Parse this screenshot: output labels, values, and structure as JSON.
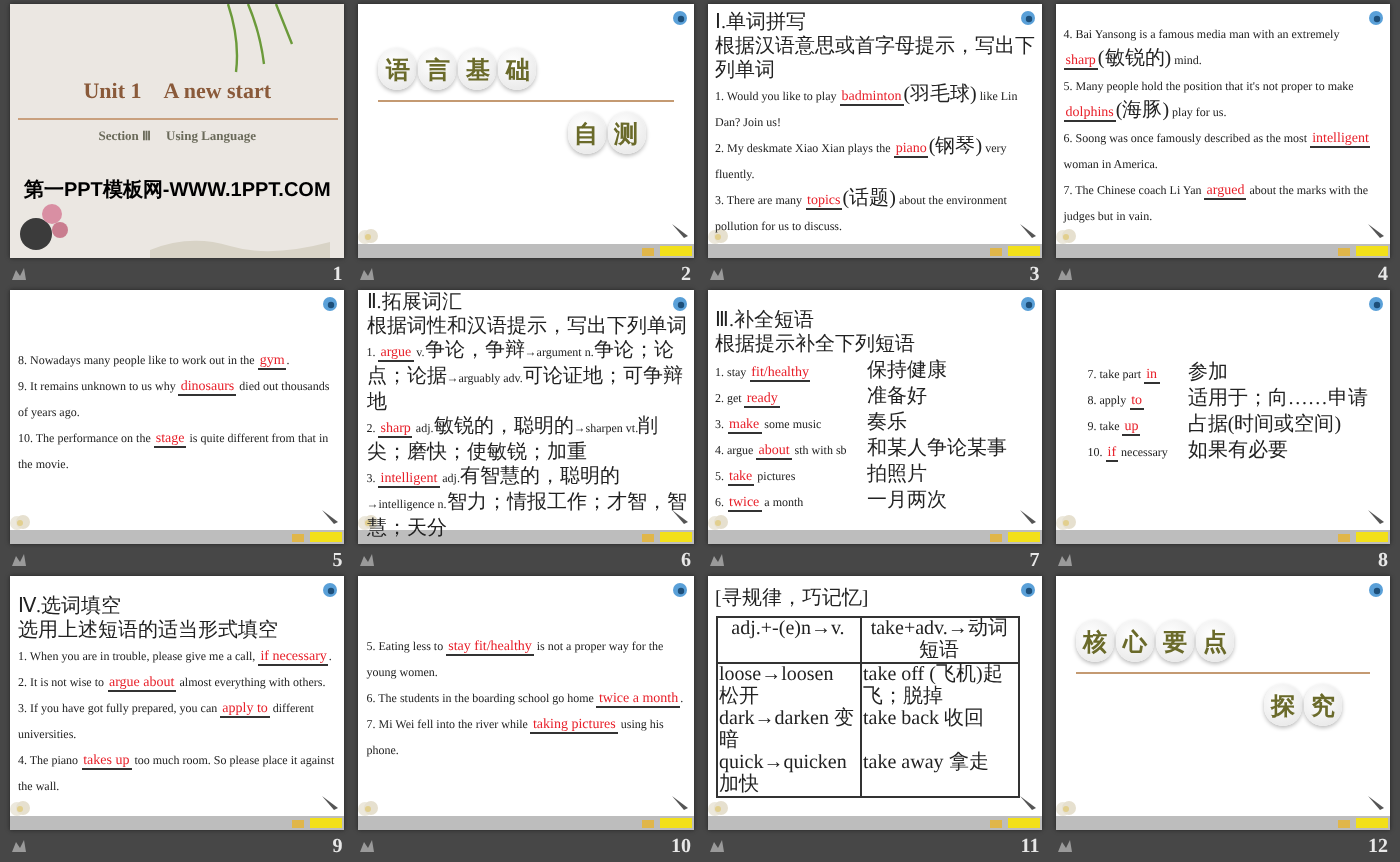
{
  "slides": [
    {
      "number": "1",
      "kind": "title",
      "title": "Unit 1　A new start",
      "subtitle": "Section Ⅲ　Using Language",
      "footer": "第一PPT模板网-WWW.1PPT.COM"
    },
    {
      "number": "2",
      "kind": "section",
      "heading_chars": [
        "语",
        "言",
        "基",
        "础"
      ],
      "sub_chars": [
        "自",
        "测"
      ]
    },
    {
      "number": "3",
      "kind": "exercise",
      "lines": [
        [
          {
            "kind": "cn",
            "text": "Ⅰ.单词拼写"
          }
        ],
        [
          {
            "kind": "cn",
            "text": "根据汉语意思或首字母提示，写出下列单词"
          }
        ],
        [
          {
            "kind": "text",
            "text": "1. Would you like to play "
          },
          {
            "kind": "answer",
            "text": "badminton"
          },
          {
            "kind": "cn",
            "text": "(羽毛球)"
          },
          {
            "kind": "text",
            "text": " like Lin Dan? Join us!"
          }
        ],
        [
          {
            "kind": "text",
            "text": "2. My deskmate Xiao Xian plays the "
          },
          {
            "kind": "answer",
            "text": "piano"
          },
          {
            "kind": "cn",
            "text": "(钢琴)"
          },
          {
            "kind": "text",
            "text": " very fluently."
          }
        ],
        [
          {
            "kind": "text",
            "text": "3. There are many "
          },
          {
            "kind": "answer",
            "text": "topics"
          },
          {
            "kind": "cn",
            "text": "(话题)"
          },
          {
            "kind": "text",
            "text": " about the environment pollution for us to discuss."
          }
        ]
      ]
    },
    {
      "number": "4",
      "kind": "exercise",
      "lines": [
        [
          {
            "kind": "text",
            "text": "4. Bai Yansong is a famous media man with an extremely "
          },
          {
            "kind": "answer",
            "text": "sharp"
          },
          {
            "kind": "cn",
            "text": "(敏锐的)"
          },
          {
            "kind": "text",
            "text": " mind."
          }
        ],
        [
          {
            "kind": "text",
            "text": "5. Many people hold the position that it's not proper to make "
          },
          {
            "kind": "answer",
            "text": "dolphins"
          },
          {
            "kind": "cn",
            "text": "(海豚)"
          },
          {
            "kind": "text",
            "text": " play for us."
          }
        ],
        [
          {
            "kind": "text",
            "text": "6. Soong was once famously described as the most "
          },
          {
            "kind": "answer",
            "text": "intelligent"
          },
          {
            "kind": "text",
            "text": " woman in America."
          }
        ],
        [
          {
            "kind": "text",
            "text": "7. The Chinese coach Li Yan "
          },
          {
            "kind": "answer",
            "text": "argued"
          },
          {
            "kind": "text",
            "text": " about the marks with the judges but in vain."
          }
        ]
      ]
    },
    {
      "number": "5",
      "kind": "exercise",
      "lines": [
        [
          {
            "kind": "text",
            "text": "8. Nowadays many people like to work out in the "
          },
          {
            "kind": "answer",
            "text": "gym"
          },
          {
            "kind": "text",
            "text": "."
          }
        ],
        [
          {
            "kind": "text",
            "text": "9. It remains unknown to us why "
          },
          {
            "kind": "answer",
            "text": "dinosaurs"
          },
          {
            "kind": "text",
            "text": " died out thousands of years ago."
          }
        ],
        [
          {
            "kind": "text",
            "text": "10. The performance on the "
          },
          {
            "kind": "answer",
            "text": "stage"
          },
          {
            "kind": "text",
            "text": " is quite different from that in the movie."
          }
        ]
      ]
    },
    {
      "number": "6",
      "kind": "exercise",
      "lines": [
        [
          {
            "kind": "cn",
            "text": "Ⅱ.拓展词汇"
          }
        ],
        [
          {
            "kind": "cn",
            "text": "根据词性和汉语提示，写出下列单词"
          }
        ],
        [
          {
            "kind": "text",
            "text": "1. "
          },
          {
            "kind": "answer",
            "text": "argue"
          },
          {
            "kind": "text",
            "text": " v."
          },
          {
            "kind": "cn",
            "text": "争论，争辩"
          },
          {
            "kind": "text",
            "text": "→argument n."
          },
          {
            "kind": "cn",
            "text": "争论；论点；论据"
          },
          {
            "kind": "text",
            "text": "→arguably adv."
          },
          {
            "kind": "cn",
            "text": "可论证地；可争辩地"
          }
        ],
        [
          {
            "kind": "text",
            "text": "2. "
          },
          {
            "kind": "answer",
            "text": "sharp"
          },
          {
            "kind": "text",
            "text": " adj."
          },
          {
            "kind": "cn",
            "text": "敏锐的，聪明的"
          },
          {
            "kind": "text",
            "text": "→sharpen vt."
          },
          {
            "kind": "cn",
            "text": "削尖；磨快；使敏锐；加重"
          }
        ],
        [
          {
            "kind": "text",
            "text": "3. "
          },
          {
            "kind": "answer",
            "text": "intelligent"
          },
          {
            "kind": "text",
            "text": " adj."
          },
          {
            "kind": "cn",
            "text": "有智慧的，聪明的"
          },
          {
            "kind": "text",
            "text": "→intelligence n."
          },
          {
            "kind": "cn",
            "text": "智力；情报工作；才智，智慧；天分"
          }
        ]
      ]
    },
    {
      "number": "7",
      "kind": "phrases",
      "lines": [
        [
          {
            "kind": "cn",
            "text": "Ⅲ.补全短语"
          }
        ],
        [
          {
            "kind": "cn",
            "text": "根据提示补全下列短语"
          }
        ]
      ],
      "phrases": [
        {
          "segments": [
            {
              "kind": "text",
              "text": "1. stay "
            },
            {
              "kind": "answer",
              "text": "fit/healthy"
            }
          ],
          "gloss": "保持健康"
        },
        {
          "segments": [
            {
              "kind": "text",
              "text": "2. get "
            },
            {
              "kind": "answer",
              "text": "ready"
            }
          ],
          "gloss": "准备好"
        },
        {
          "segments": [
            {
              "kind": "text",
              "text": "3. "
            },
            {
              "kind": "answer",
              "text": "make"
            },
            {
              "kind": "text",
              "text": " some music"
            }
          ],
          "gloss": "奏乐"
        },
        {
          "segments": [
            {
              "kind": "text",
              "text": "4. argue "
            },
            {
              "kind": "answer",
              "text": "about"
            },
            {
              "kind": "text",
              "text": " sth with sb"
            }
          ],
          "gloss": "和某人争论某事"
        },
        {
          "segments": [
            {
              "kind": "text",
              "text": "5. "
            },
            {
              "kind": "answer",
              "text": "take"
            },
            {
              "kind": "text",
              "text": " pictures"
            }
          ],
          "gloss": "拍照片"
        },
        {
          "segments": [
            {
              "kind": "text",
              "text": "6. "
            },
            {
              "kind": "answer",
              "text": "twice"
            },
            {
              "kind": "text",
              "text": " a month"
            }
          ],
          "gloss": "一月两次"
        }
      ]
    },
    {
      "number": "8",
      "kind": "phrases",
      "phrases": [
        {
          "segments": [
            {
              "kind": "text",
              "text": "7. take part "
            },
            {
              "kind": "answer",
              "text": "in"
            }
          ],
          "gloss": "参加"
        },
        {
          "segments": [
            {
              "kind": "text",
              "text": "8. apply "
            },
            {
              "kind": "answer",
              "text": "to"
            }
          ],
          "gloss": "适用于；向……申请"
        },
        {
          "segments": [
            {
              "kind": "text",
              "text": "9. take "
            },
            {
              "kind": "answer",
              "text": "up"
            }
          ],
          "gloss": "占据(时间或空间)"
        },
        {
          "segments": [
            {
              "kind": "text",
              "text": "10. "
            },
            {
              "kind": "answer",
              "text": "if"
            },
            {
              "kind": "text",
              "text": " necessary"
            }
          ],
          "gloss": "如果有必要"
        }
      ]
    },
    {
      "number": "9",
      "kind": "exercise",
      "lines": [
        [
          {
            "kind": "cn",
            "text": "Ⅳ.选词填空"
          }
        ],
        [
          {
            "kind": "cn",
            "text": "选用上述短语的适当形式填空"
          }
        ],
        [
          {
            "kind": "text",
            "text": "1. When you are in trouble, please give me a call, "
          },
          {
            "kind": "answer",
            "text": "if necessary"
          },
          {
            "kind": "text",
            "text": "."
          }
        ],
        [
          {
            "kind": "text",
            "text": "2. It is not wise to "
          },
          {
            "kind": "answer",
            "text": "argue about"
          },
          {
            "kind": "text",
            "text": " almost everything with others."
          }
        ],
        [
          {
            "kind": "text",
            "text": "3. If you have got fully prepared, you can "
          },
          {
            "kind": "answer",
            "text": "apply to"
          },
          {
            "kind": "text",
            "text": " different universities."
          }
        ],
        [
          {
            "kind": "text",
            "text": "4. The piano "
          },
          {
            "kind": "answer",
            "text": "takes up"
          },
          {
            "kind": "text",
            "text": " too much room. So please place it against the wall."
          }
        ]
      ]
    },
    {
      "number": "10",
      "kind": "exercise",
      "lines": [
        [
          {
            "kind": "text",
            "text": "5. Eating less to "
          },
          {
            "kind": "answer",
            "text": "stay fit/healthy"
          },
          {
            "kind": "text",
            "text": " is not a proper way for the young women."
          }
        ],
        [
          {
            "kind": "text",
            "text": "6. The students in the boarding school go home "
          },
          {
            "kind": "answer",
            "text": "twice a month"
          },
          {
            "kind": "text",
            "text": "."
          }
        ],
        [
          {
            "kind": "text",
            "text": "7. Mi Wei fell into the river while "
          },
          {
            "kind": "answer",
            "text": "taking pictures"
          },
          {
            "kind": "text",
            "text": " using his phone."
          }
        ]
      ]
    },
    {
      "number": "11",
      "kind": "table",
      "caption": "[寻规律，巧记忆]",
      "columns": [
        "adj.+-(e)n→v.",
        "take+adv.→动词短语"
      ],
      "rows": [
        [
          "loose→loosen 松开",
          "take off (飞机)起飞；脱掉"
        ],
        [
          "dark→darken 变暗",
          "take back 收回"
        ],
        [
          "quick→quicken 加快",
          "take away 拿走"
        ]
      ]
    },
    {
      "number": "12",
      "kind": "section",
      "heading_chars": [
        "核",
        "心",
        "要",
        "点"
      ],
      "sub_chars": [
        "探",
        "究"
      ]
    }
  ]
}
